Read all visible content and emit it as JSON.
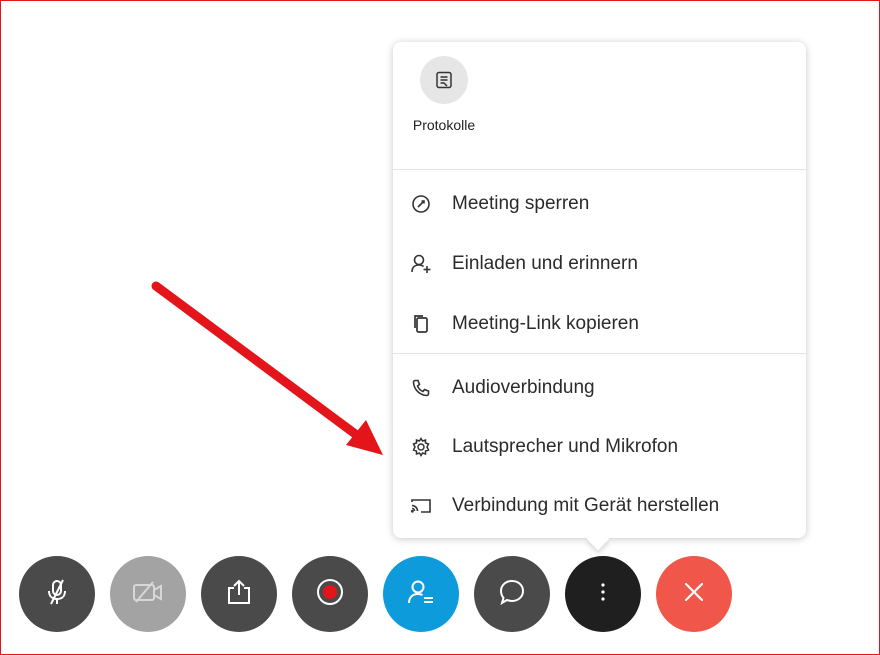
{
  "menu": {
    "protocol": {
      "label": "Protokolle",
      "icon": "notes-icon"
    },
    "items": [
      {
        "label": "Meeting sperren",
        "icon": "lock-meeting-icon"
      },
      {
        "label": "Einladen und erinnern",
        "icon": "invite-person-icon"
      },
      {
        "label": "Meeting-Link kopieren",
        "icon": "copy-icon"
      },
      {
        "label": "Audioverbindung",
        "icon": "phone-icon"
      },
      {
        "label": "Lautsprecher und Mikrofon",
        "icon": "gear-icon"
      },
      {
        "label": "Verbindung mit Gerät herstellen",
        "icon": "cast-icon"
      }
    ]
  },
  "toolbar": {
    "buttons": [
      {
        "name": "mute",
        "icon": "microphone-muted-icon",
        "color": "#4a4a4a"
      },
      {
        "name": "video",
        "icon": "video-off-icon",
        "color": "#a3a3a3"
      },
      {
        "name": "share",
        "icon": "share-icon",
        "color": "#4a4a4a"
      },
      {
        "name": "record",
        "icon": "record-icon",
        "color": "#4a4a4a"
      },
      {
        "name": "participants",
        "icon": "participants-icon",
        "color": "#0e9bdb"
      },
      {
        "name": "chat",
        "icon": "chat-icon",
        "color": "#4a4a4a"
      },
      {
        "name": "more",
        "icon": "more-vertical-icon",
        "color": "#1f1f1f"
      },
      {
        "name": "leave",
        "icon": "close-icon",
        "color": "#f0574a"
      }
    ]
  },
  "colors": {
    "annotation_arrow": "#e4141b",
    "frame_border": "#e4141b"
  }
}
